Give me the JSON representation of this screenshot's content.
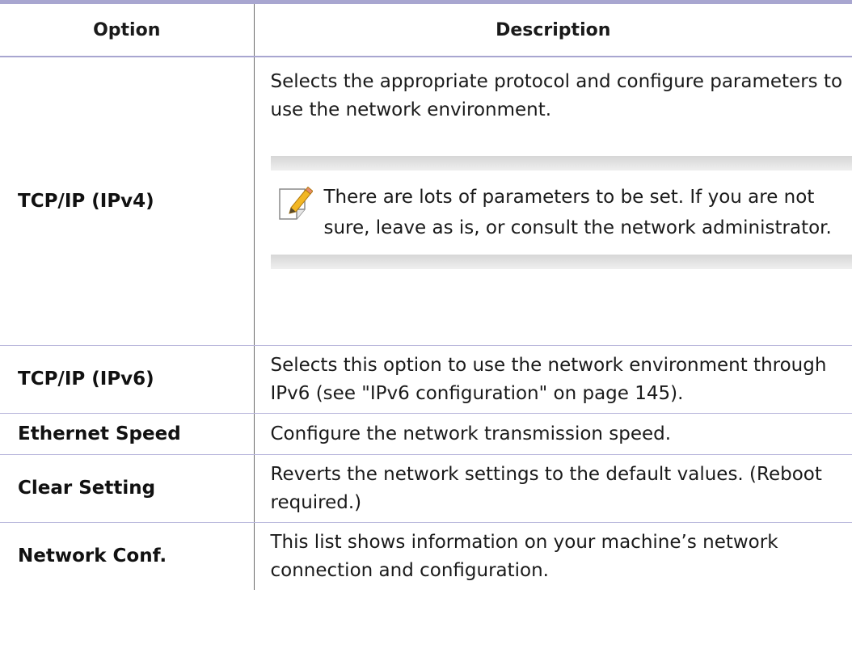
{
  "table": {
    "header": {
      "option": "Option",
      "description": "Description"
    },
    "rows": [
      {
        "option": "TCP/IP (IPv4)",
        "description": "Selects the appropriate protocol and configure parameters to use the network environment.",
        "note": "There are lots of parameters to be set. If you are not sure, leave as is, or consult the network administrator.",
        "note_icon": "note-pencil-icon"
      },
      {
        "option": "TCP/IP (IPv6)",
        "description": "Selects this option to use the network environment through IPv6 (see \"IPv6 configuration\" on page 145)."
      },
      {
        "option": "Ethernet Speed",
        "description": "Configure the network transmission speed."
      },
      {
        "option": "Clear Setting",
        "description": "Reverts the network settings to the default values. (Reboot required.)"
      },
      {
        "option": "Network Conf.",
        "description": "This list shows information on your machine’s network connection and configuration."
      }
    ]
  },
  "colors": {
    "rule": "#a8a6d0",
    "divider": "#6b6b6b",
    "note_icon_accent": "#f2b623"
  }
}
